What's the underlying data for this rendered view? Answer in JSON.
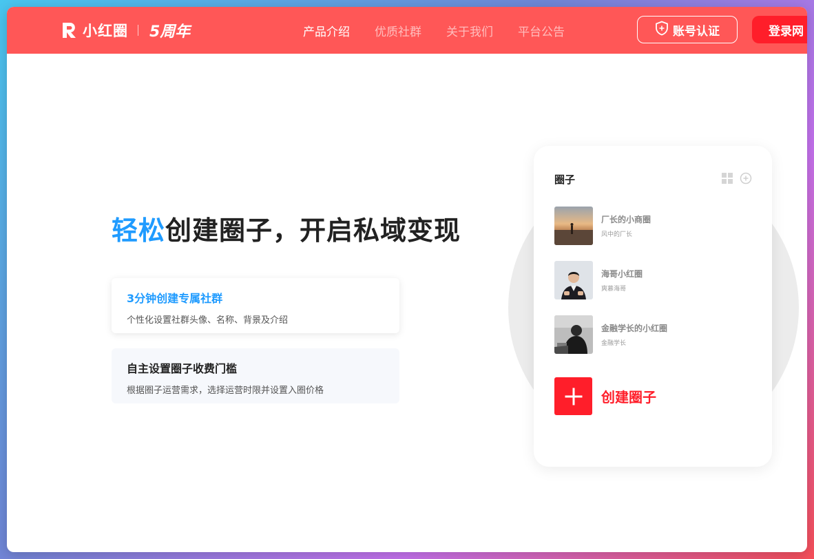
{
  "header": {
    "logo_text": "小红圈",
    "anniversary_text": "5周年",
    "nav": [
      {
        "label": "产品介绍",
        "active": true
      },
      {
        "label": "优质社群",
        "active": false
      },
      {
        "label": "关于我们",
        "active": false
      },
      {
        "label": "平台公告",
        "active": false
      }
    ],
    "verify_label": "账号认证",
    "login_label": "登录网"
  },
  "hero": {
    "title_accent": "轻松",
    "title_rest": "创建圈子，开启私域变现"
  },
  "features": [
    {
      "title": "3分钟创建专属社群",
      "desc": "个性化设置社群头像、名称、背景及介绍"
    },
    {
      "title": "自主设置圈子收费门槛",
      "desc": "根据圈子运营需求，选择运营时限并设置入圈价格"
    }
  ],
  "circle_card": {
    "title": "圈子",
    "items": [
      {
        "name": "厂长的小商圈",
        "sub": "风中的厂长"
      },
      {
        "name": "海哥小红圈",
        "sub": "爽慕海哥"
      },
      {
        "name": "金融学长的小红圈",
        "sub": "金融学长"
      }
    ],
    "create_label": "创建圈子"
  },
  "colors": {
    "brand_red": "#ff5757",
    "accent_blue": "#1f9bff",
    "create_red": "#ff1e2a"
  },
  "icons": {
    "logo": "r-logo-icon",
    "verify": "shield-icon",
    "grid": "grid-icon",
    "add": "plus-circle-icon",
    "create": "plus-icon"
  }
}
